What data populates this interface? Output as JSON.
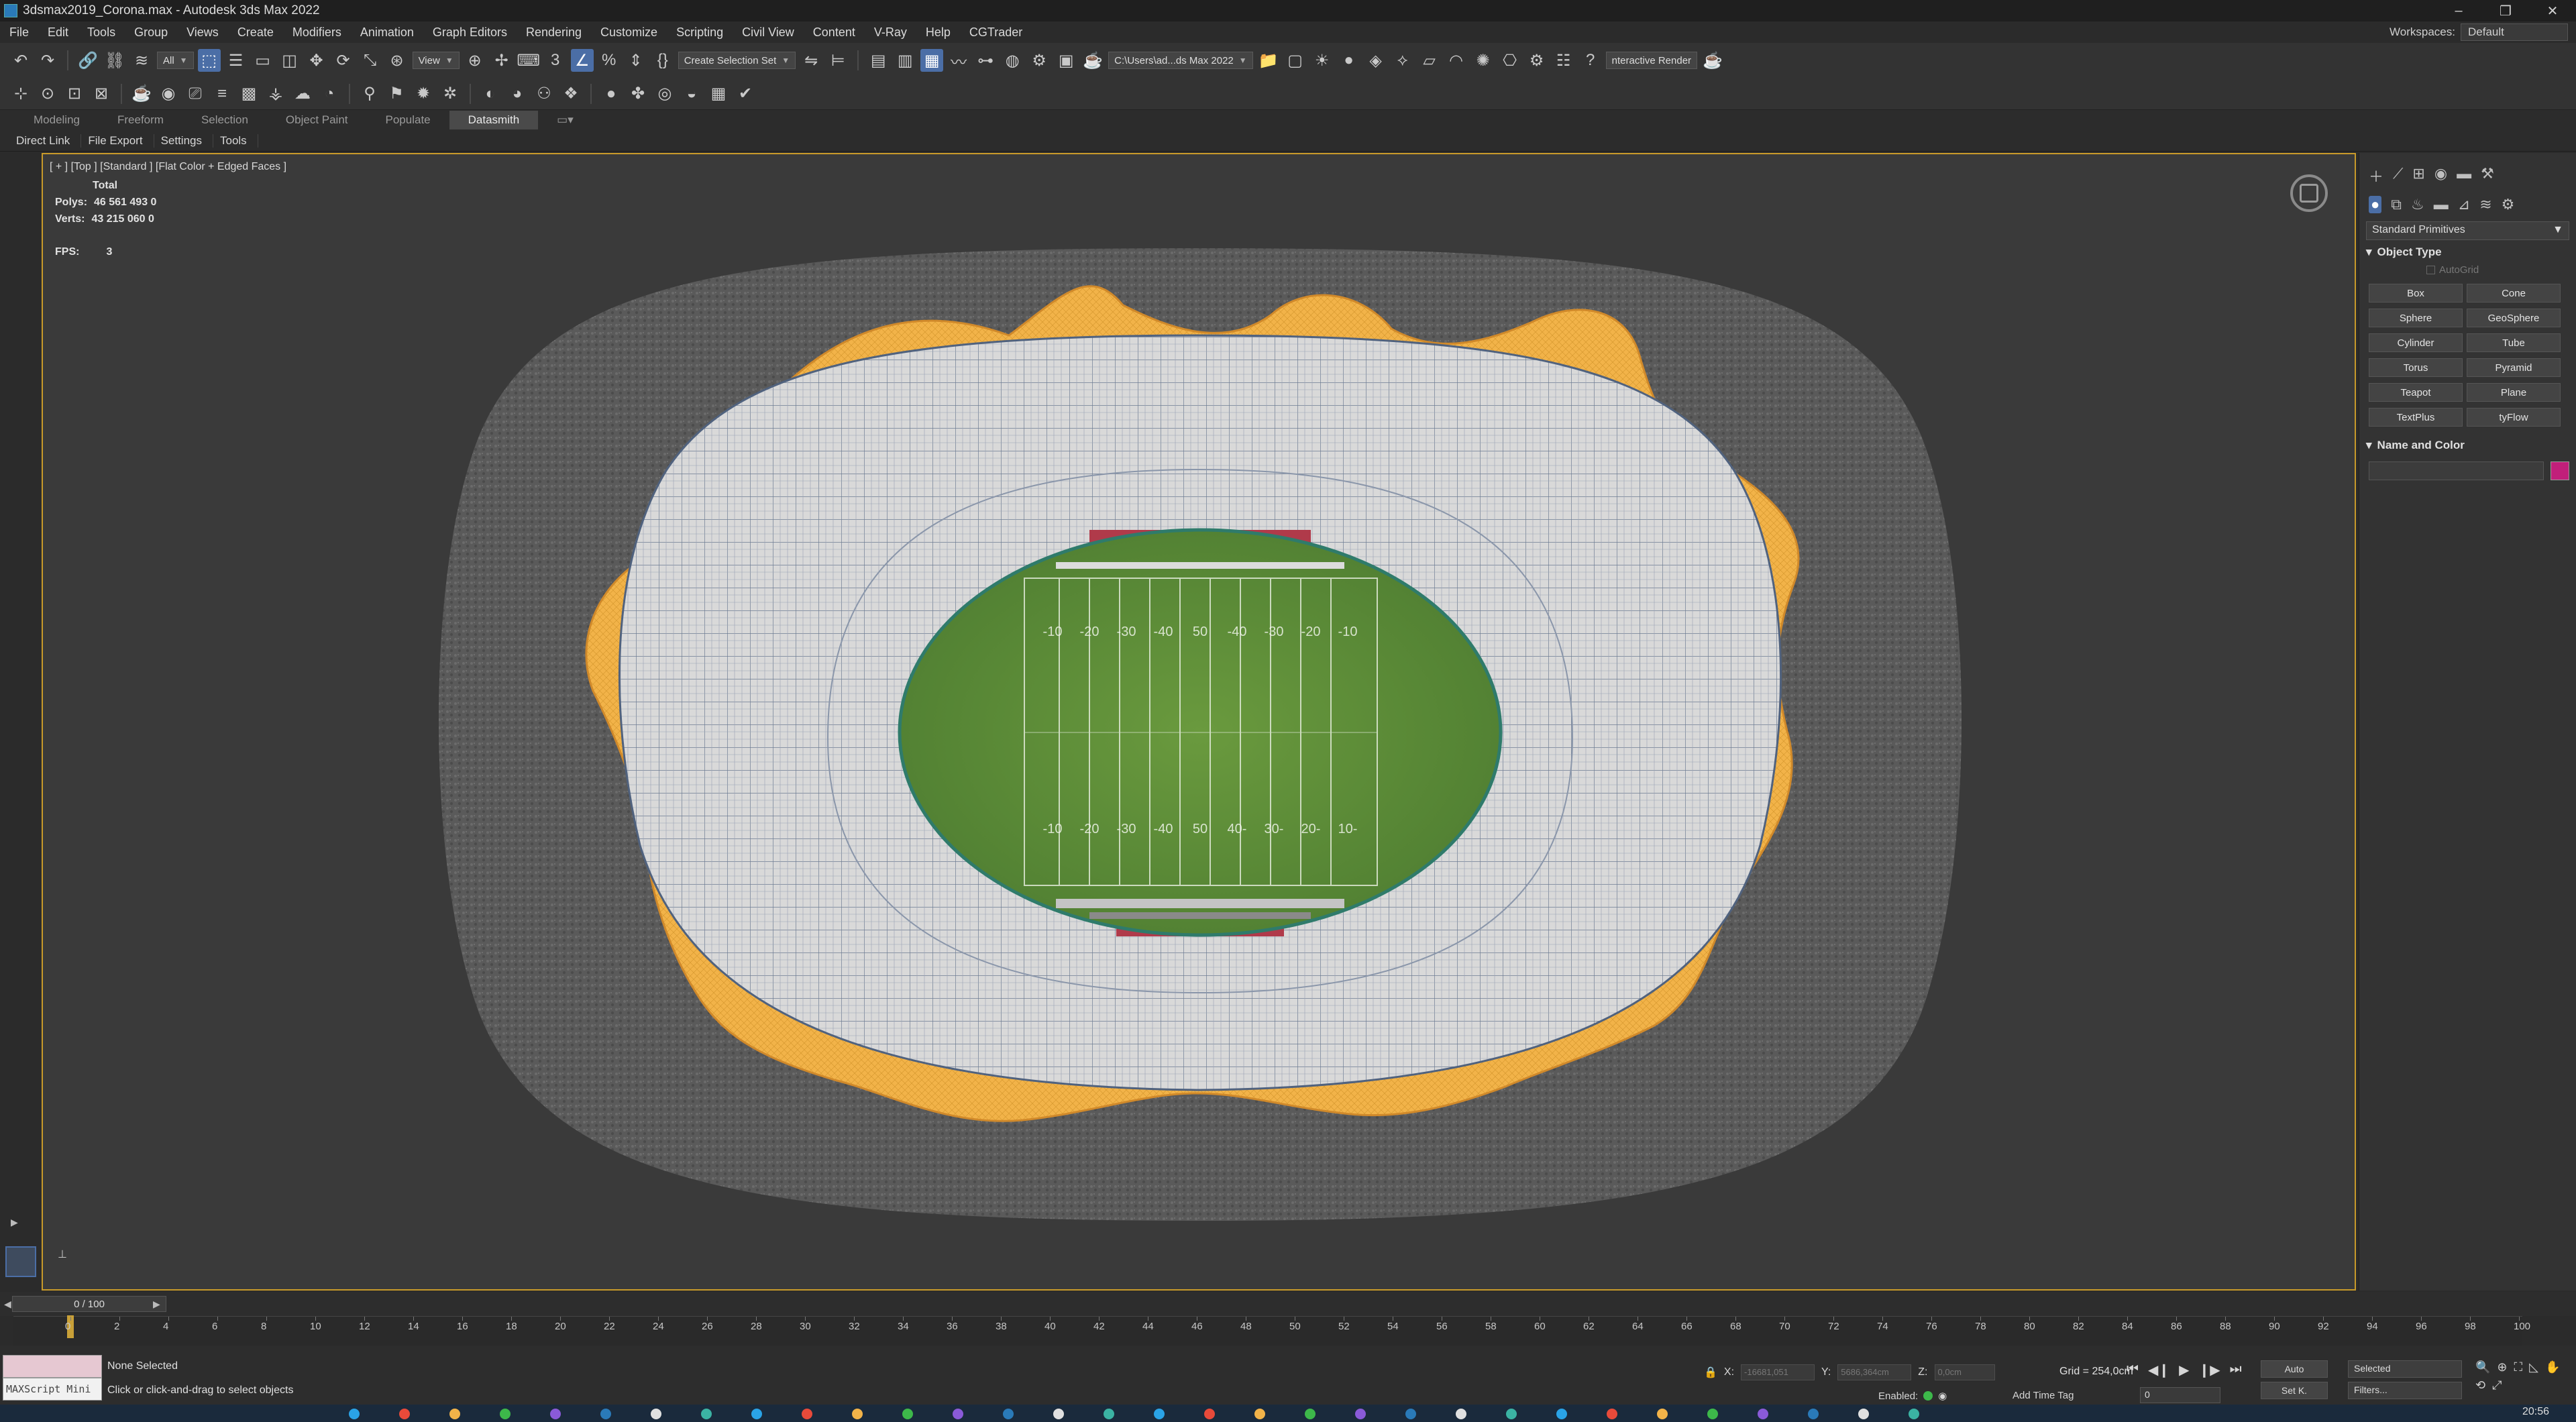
{
  "window": {
    "title": "3dsmax2019_Corona.max - Autodesk 3ds Max 2022",
    "controls": {
      "minimize": "–",
      "restore": "❐",
      "close": "✕"
    }
  },
  "menu": {
    "items": [
      "File",
      "Edit",
      "Tools",
      "Group",
      "Views",
      "Create",
      "Modifiers",
      "Animation",
      "Graph Editors",
      "Rendering",
      "Customize",
      "Scripting",
      "Civil View",
      "Content",
      "V-Ray",
      "Help",
      "CGTrader"
    ],
    "workspaces_label": "Workspaces:",
    "workspace_value": "Default"
  },
  "toolbar": {
    "selection_filter": "All",
    "ref_coord": "View",
    "create_selection_set": "Create Selection Set",
    "project_path": "C:\\Users\\ad...ds Max 2022",
    "interactive_render": "nteractive Render",
    "colors": {
      "active": "#4b6ea6"
    }
  },
  "ribbon": {
    "tabs": [
      "Modeling",
      "Freeform",
      "Selection",
      "Object Paint",
      "Populate",
      "Datasmith"
    ],
    "active_tab": "Datasmith",
    "subtabs": [
      "Direct Link",
      "File Export",
      "Settings",
      "Tools"
    ]
  },
  "viewport": {
    "label": "[ + ] [Top ] [Standard ] [Flat Color + Edged Faces ]",
    "stats": {
      "header": "Total",
      "polys_label": "Polys:",
      "polys": "46 561 493  0",
      "verts_label": "Verts:",
      "verts": "43 215 060  0",
      "fps_label": "FPS:",
      "fps": "3"
    },
    "field_yardlines_top": [
      "-10",
      "-20",
      "-30",
      "-40",
      "50",
      "-40",
      "-30",
      "-20",
      "-10"
    ],
    "field_yardlines_bottom": [
      "-10",
      "-20",
      "-30",
      "-40",
      "50",
      "40-",
      "30-",
      "20-",
      "10-"
    ],
    "colors": {
      "border": "#c89a2a",
      "canopy": "#f2b349",
      "field": "#5f8f3a"
    }
  },
  "command_panel": {
    "dropdown": "Standard Primitives",
    "object_type_label": "Object Type",
    "autogrid_label": "AutoGrid",
    "buttons": [
      "Box",
      "Cone",
      "Sphere",
      "GeoSphere",
      "Cylinder",
      "Tube",
      "Torus",
      "Pyramid",
      "Teapot",
      "Plane",
      "TextPlus",
      "tyFlow"
    ],
    "name_and_color_label": "Name and Color",
    "color_swatch": "#c11f7a"
  },
  "timeline": {
    "frame_display": "0 / 100",
    "ticks": [
      "0",
      "2",
      "4",
      "6",
      "8",
      "10",
      "12",
      "14",
      "16",
      "18",
      "20",
      "22",
      "24",
      "26",
      "28",
      "30",
      "32",
      "34",
      "36",
      "38",
      "40",
      "42",
      "44",
      "46",
      "48",
      "50",
      "52",
      "54",
      "56",
      "58",
      "60",
      "62",
      "64",
      "66",
      "68",
      "70",
      "72",
      "74",
      "76",
      "78",
      "80",
      "82",
      "84",
      "86",
      "88",
      "90",
      "92",
      "94",
      "96",
      "98",
      "100"
    ]
  },
  "status": {
    "maxscript_label": "MAXScript Mini",
    "selection": "None Selected",
    "prompt": "Click or click-and-drag to select objects",
    "x_label": "X:",
    "x_value": "-16681,051",
    "y_label": "Y:",
    "y_value": "5686,364cm",
    "z_label": "Z:",
    "z_value": "0,0cm",
    "grid": "Grid = 254,0cm",
    "enabled_label": "Enabled:",
    "add_time_tag": "Add Time Tag",
    "frame_value": "0",
    "auto_label": "Auto",
    "setk_label": "Set K.",
    "selected_filter": "Selected",
    "filters_label": "Filters..."
  },
  "clock": "20:56"
}
